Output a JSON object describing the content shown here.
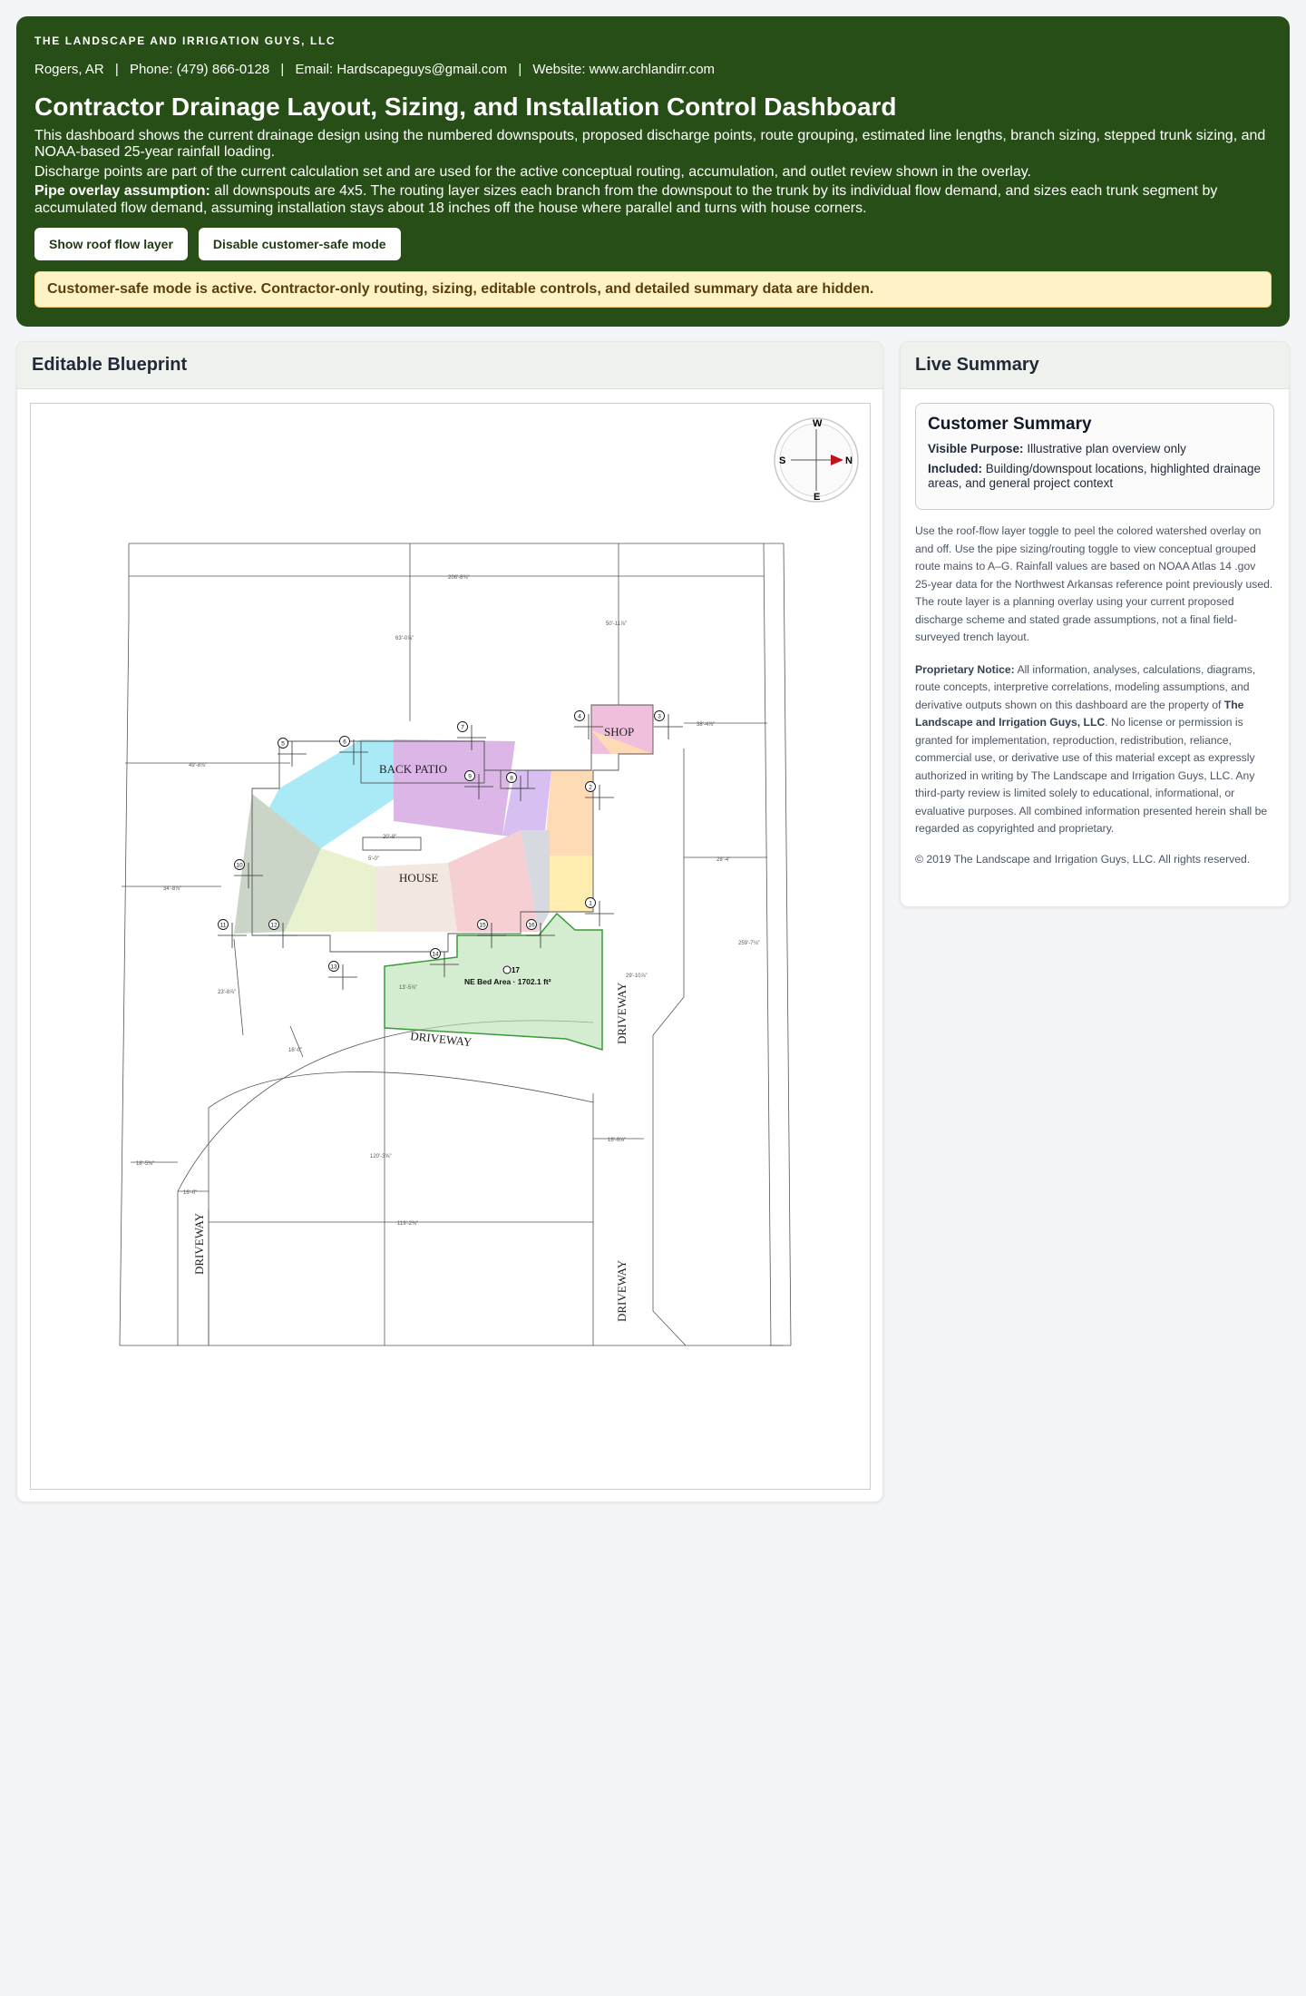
{
  "header": {
    "company": "THE LANDSCAPE AND IRRIGATION GUYS, LLC",
    "location": "Rogers, AR",
    "phone": "Phone: (479) 866-0128",
    "email": "Email: Hardscapeguys@gmail.com",
    "website": "Website: www.archlandirr.com",
    "separator": "|",
    "title": "Contractor Drainage Layout, Sizing, and Installation Control Dashboard",
    "intro": "This dashboard shows the current drainage design using the numbered downspouts, proposed discharge points, route grouping, estimated line lengths, branch sizing, stepped trunk sizing, and NOAA-based 25-year rainfall loading.",
    "discharge_note": "Discharge points are part of the current calculation set and are used for the active conceptual routing, accumulation, and outlet review shown in the overlay.",
    "pipe_label": "Pipe overlay assumption:",
    "pipe_text": "all downspouts are 4x5. The routing layer sizes each branch from the downspout to the trunk by its individual flow demand, and sizes each trunk segment by accumulated flow demand, assuming installation stays about 18 inches off the house where parallel and turns with house corners.",
    "buttons": {
      "roof_flow": "Show roof flow layer",
      "customer_safe": "Disable customer-safe mode"
    },
    "notice": "Customer-safe mode is active. Contractor-only routing, sizing, editable controls, and detailed summary data are hidden."
  },
  "blueprint": {
    "heading": "Editable Blueprint",
    "compass": {
      "w": "W",
      "s": "S",
      "n": "N",
      "e": "E"
    },
    "labels": {
      "back_patio": "BACK PATIO",
      "shop": "SHOP",
      "house": "HOUSE",
      "driveway": "DRIVEWAY",
      "ne_bed": "NE Bed Area · 1702.1 ft²",
      "point_17": "17"
    },
    "downspouts": [
      "1",
      "2",
      "3",
      "4",
      "5",
      "6",
      "7",
      "8",
      "9",
      "10",
      "11",
      "12",
      "13",
      "14",
      "15",
      "16"
    ],
    "dimensions": {
      "top": "206'-8⅜\"",
      "north_drop": "63'-0⅞\"",
      "shop_drop": "50'-11⅞\"",
      "shop_right": "38'-4⅞\"",
      "west_upper": "49'-8⅞\"",
      "west_mid": "34'-8⅞\"",
      "east_mid": "28'-4\"",
      "east_long": "259'-7⅛\"",
      "porch": "20'-8\"",
      "porch_sub": "5'-0\"",
      "bed_left": "13'-5⅞\"",
      "drive_top": "29'-10⅞\"",
      "sw_a": "23'-8⅞\"",
      "sw_b": "16'-0\"",
      "center_long": "120'-3⅝\"",
      "right_mid": "16'-6⅝\"",
      "left_far": "18'-5⅜\"",
      "left_drive": "16'-0\"",
      "bottom": "119'-2⅜\""
    }
  },
  "summary": {
    "heading": "Live Summary",
    "customer_title": "Customer Summary",
    "visible_purpose_label": "Visible Purpose:",
    "visible_purpose": "Illustrative plan overview only",
    "included_label": "Included:",
    "included": "Building/downspout locations, highlighted drainage areas, and general project context",
    "usage": "Use the roof-flow layer toggle to peel the colored watershed overlay on and off. Use the pipe sizing/routing toggle to view conceptual grouped route mains to A–G. Rainfall values are based on NOAA Atlas 14 .gov 25-year data for the Northwest Arkansas reference point previously used. The route layer is a planning overlay using your current proposed discharge scheme and stated grade assumptions, not a final field-surveyed trench layout.",
    "notice_label": "Proprietary Notice:",
    "notice_1": "All information, analyses, calculations, diagrams, route concepts, interpretive correlations, modeling assumptions, and derivative outputs shown on this dashboard are the property of",
    "notice_company": "The Landscape and Irrigation Guys, LLC",
    "notice_2": ". No license or permission is granted for implementation, reproduction, redistribution, reliance, commercial use, or derivative use of this material except as expressly authorized in writing by The Landscape and Irrigation Guys, LLC. Any third-party review is limited solely to educational, informational, or evaluative purposes. All combined information presented herein shall be regarded as copyrighted and proprietary.",
    "copyright": "© 2019 The Landscape and Irrigation Guys, LLC. All rights reserved."
  }
}
